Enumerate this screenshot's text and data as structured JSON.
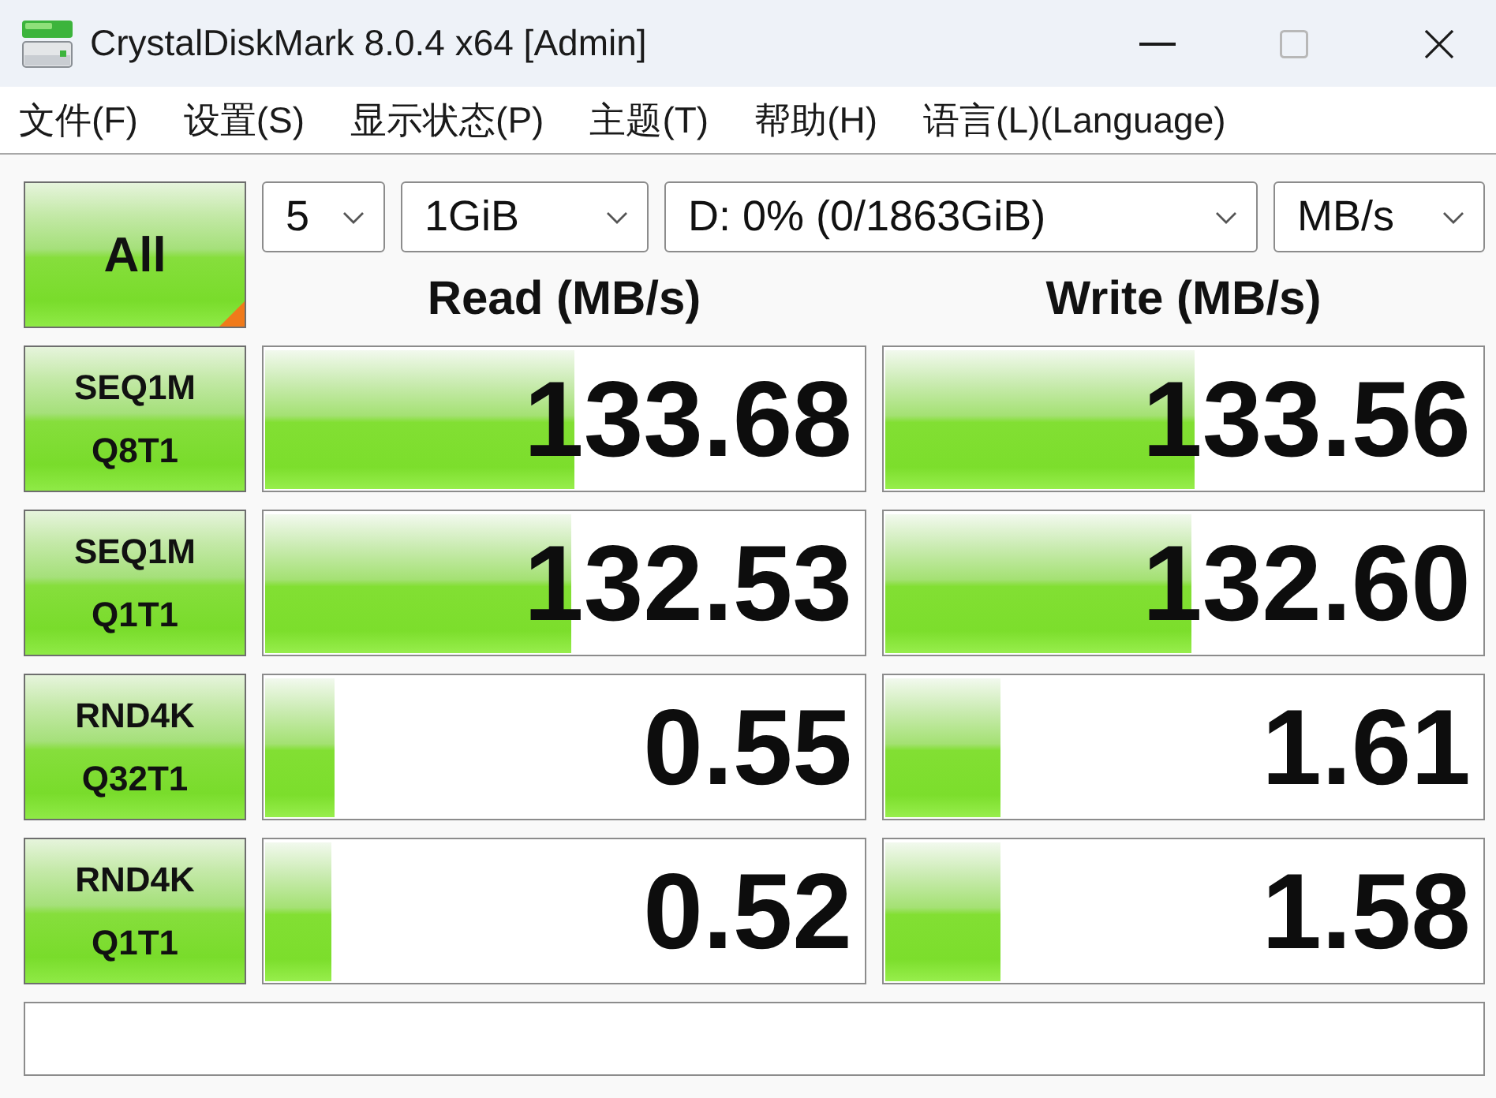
{
  "window": {
    "title": "CrystalDiskMark 8.0.4 x64 [Admin]",
    "maximize_disabled": true
  },
  "menu": [
    {
      "label": "文件(F)"
    },
    {
      "label": "设置(S)"
    },
    {
      "label": "显示状态(P)"
    },
    {
      "label": "主题(T)"
    },
    {
      "label": "帮助(H)"
    },
    {
      "label": "语言(L)(Language)"
    }
  ],
  "all_button": {
    "label": "All"
  },
  "dropdowns": [
    {
      "value": "5"
    },
    {
      "value": "1GiB"
    },
    {
      "value": "D: 0% (0/1863GiB)"
    },
    {
      "value": "MB/s"
    }
  ],
  "columns": [
    {
      "label": "Read (MB/s)"
    },
    {
      "label": "Write (MB/s)"
    }
  ],
  "tests": [
    {
      "name": "SEQ1M",
      "params": "Q8T1",
      "read": {
        "value": "133.68",
        "level": 0.517
      },
      "write": {
        "value": "133.56",
        "level": 0.518
      }
    },
    {
      "name": "SEQ1M",
      "params": "Q1T1",
      "read": {
        "value": "132.53",
        "level": 0.512
      },
      "write": {
        "value": "132.60",
        "level": 0.513
      }
    },
    {
      "name": "RND4K",
      "params": "Q32T1",
      "read": {
        "value": "0.55",
        "level": 0.117
      },
      "write": {
        "value": "1.61",
        "level": 0.194
      }
    },
    {
      "name": "RND4K",
      "params": "Q1T1",
      "read": {
        "value": "0.52",
        "level": 0.112
      },
      "write": {
        "value": "1.58",
        "level": 0.194
      }
    }
  ]
}
